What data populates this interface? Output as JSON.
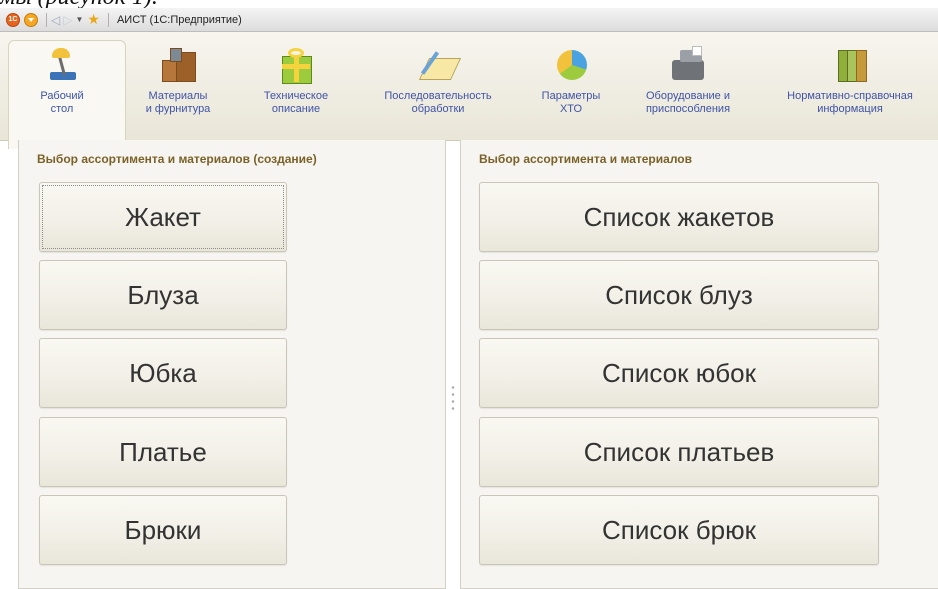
{
  "caption_fragment": "мы (рисунок 1).",
  "window": {
    "title": "АИСТ  (1С:Предприятие)",
    "logo_text": "1С"
  },
  "sections": [
    {
      "label_line1": "Рабочий",
      "label_line2": "стол",
      "icon": "desk-lamp-icon",
      "active": true
    },
    {
      "label_line1": "Материалы",
      "label_line2": "и фурнитура",
      "icon": "boxes-icon"
    },
    {
      "label_line1": "Техническое",
      "label_line2": "описание",
      "icon": "gift-box-icon"
    },
    {
      "label_line1": "Последовательность",
      "label_line2": "обработки",
      "icon": "document-pen-icon"
    },
    {
      "label_line1": "Параметры",
      "label_line2": "ХТО",
      "icon": "pie-chart-icon"
    },
    {
      "label_line1": "Оборудование и",
      "label_line2": "приспособления",
      "icon": "cash-register-icon"
    },
    {
      "label_line1": "Нормативно-справочная",
      "label_line2": "информация",
      "icon": "books-icon"
    }
  ],
  "left_pane": {
    "title": "Выбор ассортимента и материалов (создание)",
    "buttons": [
      "Жакет",
      "Блуза",
      "Юбка",
      "Платье",
      "Брюки"
    ]
  },
  "right_pane": {
    "title": "Выбор ассортимента и материалов",
    "buttons": [
      "Список жакетов",
      "Список блуз",
      "Список юбок",
      "Список платьев",
      "Список брюк"
    ]
  },
  "colors": {
    "section_label": "#3f53a6",
    "pane_title": "#7a6228",
    "pane_bg": "#f6f5f1"
  }
}
